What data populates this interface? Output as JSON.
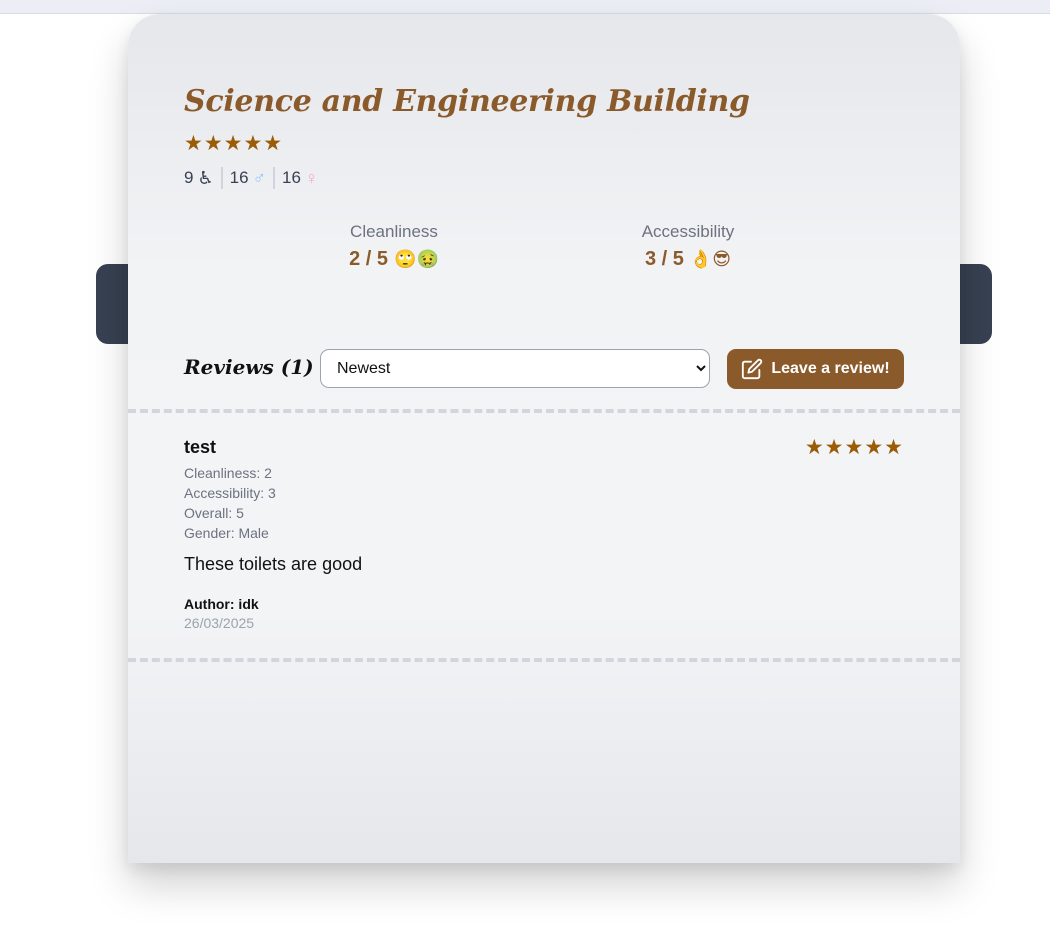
{
  "building": {
    "name": "Science and Engineering Building",
    "rating_stars": "★★★★★",
    "overall_rating": 5,
    "counts": {
      "accessible": {
        "value": "9",
        "icon": "♿"
      },
      "male": {
        "value": "16",
        "icon": "♂"
      },
      "female": {
        "value": "16",
        "icon": "♀"
      }
    }
  },
  "stats": {
    "cleanliness": {
      "label": "Cleanliness",
      "value": "2 / 5",
      "emoji": "🙄🤢"
    },
    "accessibility": {
      "label": "Accessibility",
      "value": "3 / 5",
      "emoji": "👌😎"
    }
  },
  "reviews_section": {
    "heading": "Reviews (1)",
    "sort_selected": "Newest",
    "leave_review_label": "Leave a review!"
  },
  "reviews": [
    {
      "title": "test",
      "stars": "★★★★★",
      "cleanliness": "Cleanliness: 2",
      "accessibility": "Accessibility: 3",
      "overall": "Overall: 5",
      "gender": "Gender: Male",
      "text": "These toilets are good",
      "author": "Author: idk",
      "date": "26/03/2025"
    }
  ],
  "colors": {
    "accent": "#8b5a2b",
    "star": "#9a5c06",
    "backdrop": "#374151"
  }
}
